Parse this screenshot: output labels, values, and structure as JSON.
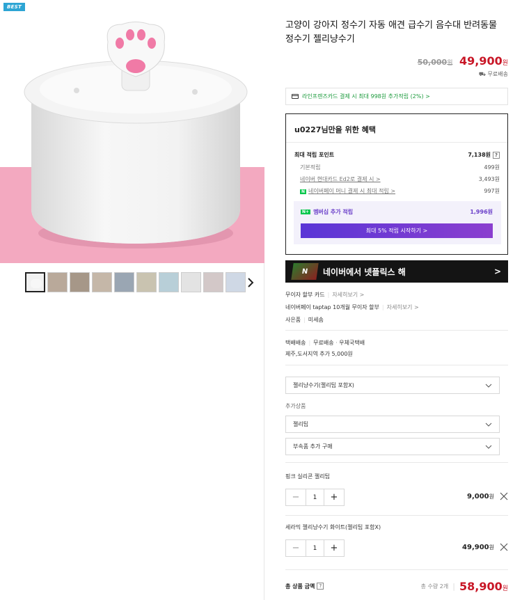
{
  "badge": "BEST",
  "product": {
    "title": "고양이 강아지 정수기 자동 애견 급수기 음수대 반려동물 정수기 젤리냥수기",
    "original_price": "50,000",
    "sale_price": "49,900",
    "currency": "원",
    "shipping": "무료배송"
  },
  "card_benefit": "라인프렌즈카드 결제 시 최대 998원 추가적립 (2%) >",
  "benefits": {
    "heading": "u0227님만을 위한 혜택",
    "max_label": "최대 적립 포인트",
    "max_value": "7,138원",
    "help": "?",
    "rows": [
      {
        "label": "기본적립",
        "value": "499원"
      },
      {
        "label": "네이버 현대카드 Ed2로 결제 시 >",
        "value": "3,493원"
      },
      {
        "label": "네이버페이 머니 결제 시 최대 적립 >",
        "value": "997원"
      }
    ],
    "npay_badge": "N",
    "member_plus": "N+",
    "member_label": "멤버십 추가 적립",
    "member_value": "1,996원",
    "member_button": "최대 5% 적립 시작하기 >"
  },
  "netflix": {
    "logo": "N",
    "text": "네이버에서 넷플릭스 해",
    "arrow": ">"
  },
  "installment": {
    "line1_label": "무이자 할부 카드",
    "line1_link": "자세히보기 >",
    "line2_label": "네이버페이 taptap 10개월 무이자 할부",
    "line2_link": "자세히보기 >",
    "line3_label": "사은품",
    "line3_value": "미세솜"
  },
  "delivery": {
    "type": "택배배송",
    "fee": "무료배송",
    "method": "우체국택배",
    "extra": "제주,도서지역 추가 5,000원"
  },
  "options": {
    "main_select": "젤리냥수기(젤리팁 포함X)",
    "addon_label": "추가상품",
    "addon_select": "젤리팁",
    "accessory_select": "부속품 추가 구매"
  },
  "selected": [
    {
      "name": "핑크 실리콘 젤리팁",
      "qty": "1",
      "price": "9,000",
      "minus": "−",
      "plus": "+"
    },
    {
      "name": "세라믹 젤리냥수기 화이트(젤리팁 포함X)",
      "qty": "1",
      "price": "49,900",
      "minus": "−",
      "plus": "+"
    }
  ],
  "total": {
    "label": "총 상품 금액",
    "help": "?",
    "qty_text": "총 수량 2개",
    "price": "58,900",
    "currency": "원"
  }
}
